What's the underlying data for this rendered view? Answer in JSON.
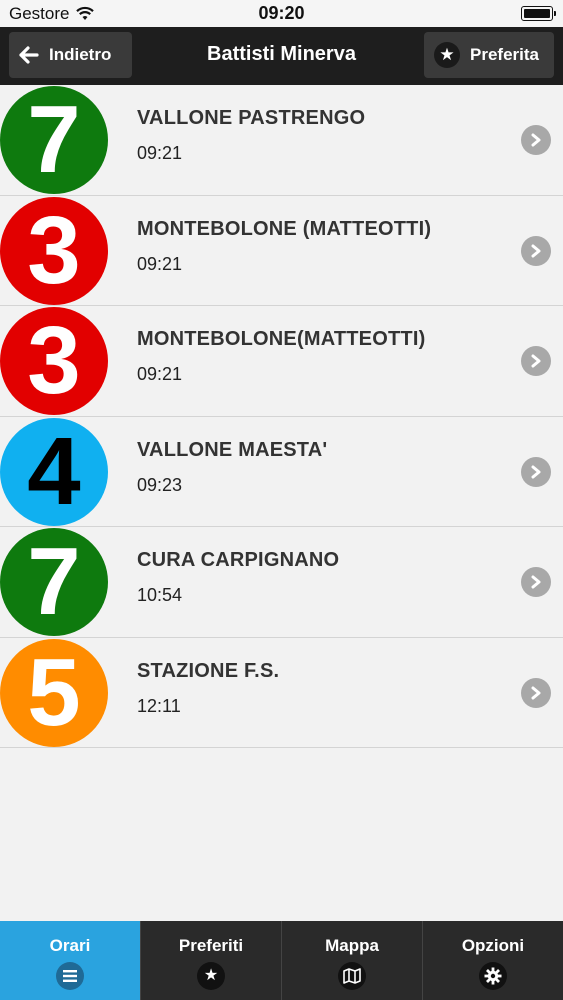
{
  "status_bar": {
    "carrier": "Gestore",
    "time": "09:20"
  },
  "nav": {
    "back_label": "Indietro",
    "title": "Battisti Minerva",
    "favorite_label": "Preferita"
  },
  "departures": [
    {
      "line": "7",
      "destination": "VALLONE PASTRENGO",
      "time": "09:21",
      "badge_color": "#0e7a0e",
      "digit_color": "#ffffff"
    },
    {
      "line": "3",
      "destination": "MONTEBOLONE (MATTEOTTI)",
      "time": "09:21",
      "badge_color": "#e20000",
      "digit_color": "#ffffff"
    },
    {
      "line": "3",
      "destination": "MONTEBOLONE(MATTEOTTI)",
      "time": "09:21",
      "badge_color": "#e20000",
      "digit_color": "#ffffff"
    },
    {
      "line": "4",
      "destination": "VALLONE MAESTA'",
      "time": "09:23",
      "badge_color": "#10b0f0",
      "digit_color": "#000000"
    },
    {
      "line": "7",
      "destination": "CURA CARPIGNANO",
      "time": "10:54",
      "badge_color": "#0e7a0e",
      "digit_color": "#ffffff"
    },
    {
      "line": "5",
      "destination": "STAZIONE F.S.",
      "time": "12:11",
      "badge_color": "#ff8c00",
      "digit_color": "#ffffff"
    }
  ],
  "tabs": [
    {
      "label": "Orari",
      "icon": "list-icon",
      "active": true
    },
    {
      "label": "Preferiti",
      "icon": "star-icon",
      "active": false
    },
    {
      "label": "Mappa",
      "icon": "map-icon",
      "active": false
    },
    {
      "label": "Opzioni",
      "icon": "gear-icon",
      "active": false
    }
  ]
}
